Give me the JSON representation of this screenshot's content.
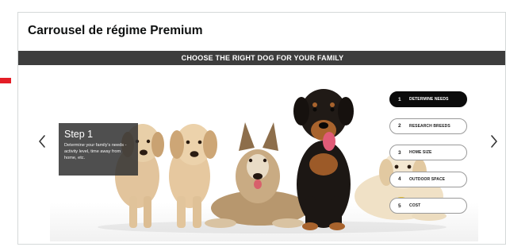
{
  "card": {
    "title": "Carrousel de régime Premium"
  },
  "banner": {
    "text": "CHOOSE THE RIGHT DOG FOR YOUR FAMILY"
  },
  "slide": {
    "step_title": "Step 1",
    "step_description": "Determine your family's needs - activity level, time away from home, etc."
  },
  "steps": [
    {
      "number": "1",
      "label": "DETERMINE NEEDS",
      "active": true
    },
    {
      "number": "2",
      "label": "RESEARCH BREEDS",
      "active": false
    },
    {
      "number": "3",
      "label": "HOME SIZE",
      "active": false
    },
    {
      "number": "4",
      "label": "OUTDOOR SPACE",
      "active": false
    },
    {
      "number": "5",
      "label": "COST",
      "active": false
    }
  ],
  "nav": {
    "prev_icon": "chevron-left-icon",
    "next_icon": "chevron-right-icon"
  },
  "colors": {
    "marker": "#e41e26",
    "banner_bg": "#3d3d3d",
    "active_step": "#0b0b0b"
  }
}
